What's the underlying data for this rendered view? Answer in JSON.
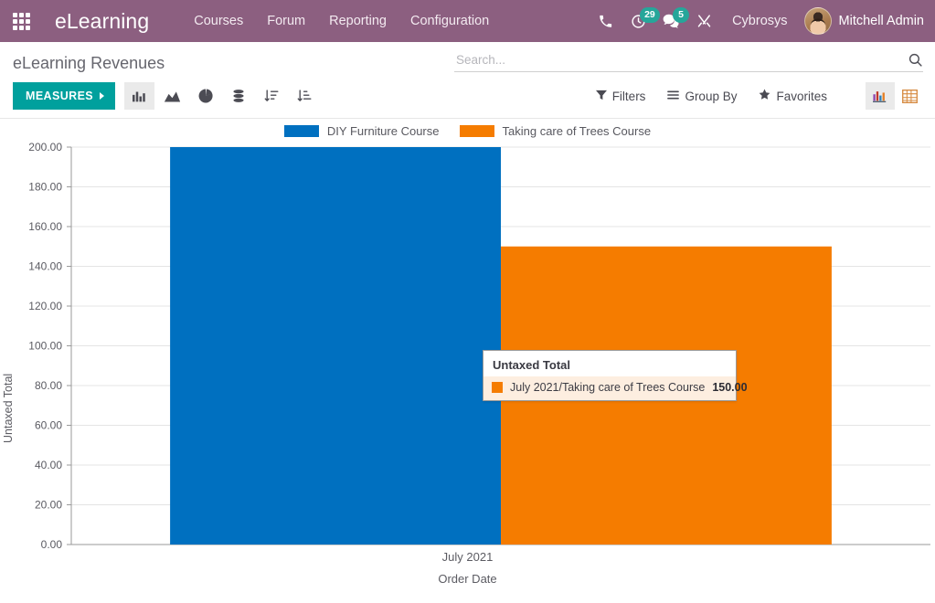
{
  "navbar": {
    "apps_icon": "apps-grid-icon",
    "brand": "eLearning",
    "menu": [
      {
        "label": "Courses"
      },
      {
        "label": "Forum"
      },
      {
        "label": "Reporting"
      },
      {
        "label": "Configuration"
      }
    ],
    "icons": [
      {
        "name": "phone-icon",
        "badge": null
      },
      {
        "name": "activity-clock-icon",
        "badge": "29"
      },
      {
        "name": "messages-icon",
        "badge": "5"
      },
      {
        "name": "developer-tools-icon",
        "badge": null
      }
    ],
    "company": "Cybrosys",
    "user_name": "Mitchell Admin",
    "avatar_icon": "user-avatar",
    "colors": {
      "background": "#8c5f80",
      "badge": "#26a69a"
    }
  },
  "control_panel": {
    "page_title": "eLearning Revenues",
    "search": {
      "placeholder": "Search...",
      "value": "",
      "icon": "search-icon"
    },
    "measures_label": "MEASURES",
    "chart_type_buttons": [
      {
        "name": "bar-chart-icon",
        "active": true
      },
      {
        "name": "line-chart-icon",
        "active": false
      },
      {
        "name": "pie-chart-icon",
        "active": false
      },
      {
        "name": "stacked-icon",
        "active": false
      },
      {
        "name": "sort-descending-icon",
        "active": false
      },
      {
        "name": "sort-ascending-icon",
        "active": false
      }
    ],
    "filters": [
      {
        "label": "Filters",
        "icon": "filter-icon"
      },
      {
        "label": "Group By",
        "icon": "group-by-icon"
      },
      {
        "label": "Favorites",
        "icon": "star-icon"
      }
    ],
    "view_toggles": [
      {
        "name": "graph-view-icon",
        "active": true
      },
      {
        "name": "pivot-view-icon",
        "active": false
      }
    ],
    "colors": {
      "measures_button": "#00a09d",
      "active_toggle_bg": "#eaeaea"
    }
  },
  "chart_data": {
    "type": "bar",
    "title": "",
    "xlabel": "Order Date",
    "ylabel": "Untaxed Total",
    "categories": [
      "July 2021"
    ],
    "series": [
      {
        "name": "DIY Furniture Course",
        "color": "#0070c0",
        "values": [
          200.0
        ]
      },
      {
        "name": "Taking care of Trees Course",
        "color": "#f57c00",
        "values": [
          150.0
        ]
      }
    ],
    "ylim": [
      0,
      200
    ],
    "yticks": [
      "0.00",
      "20.00",
      "40.00",
      "60.00",
      "80.00",
      "100.00",
      "120.00",
      "140.00",
      "160.00",
      "180.00",
      "200.00"
    ],
    "xticks": [
      "July 2021"
    ],
    "grid": true,
    "legend_position": "top"
  },
  "tooltip": {
    "title": "Untaxed Total",
    "rows": [
      {
        "swatch_color": "#f57c00",
        "key": "July 2021/Taking care of Trees Course",
        "value": "150.00",
        "highlight": true
      }
    ]
  }
}
